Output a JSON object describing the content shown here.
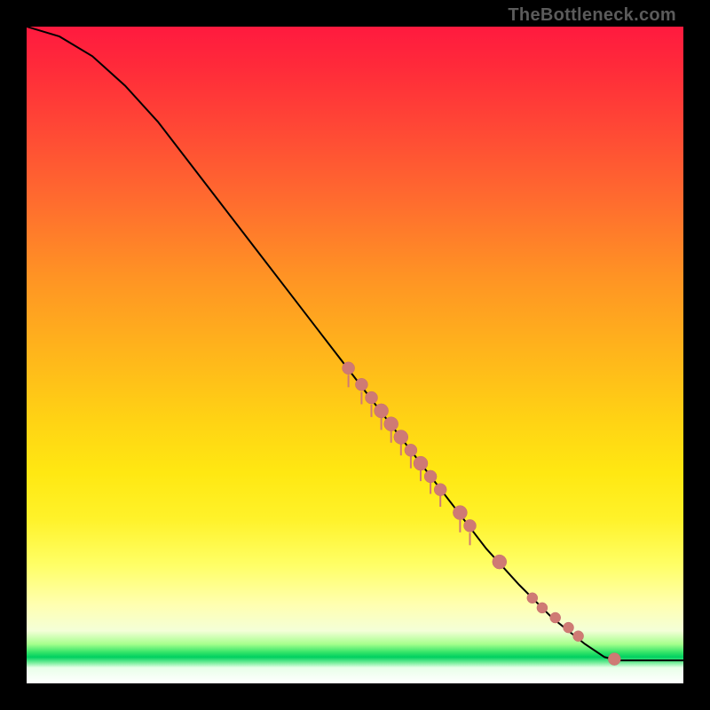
{
  "watermark": "TheBottleneck.com",
  "colors": {
    "point_fill": "#cf7a74",
    "curve_stroke": "#000000"
  },
  "chart_data": {
    "type": "line",
    "title": "",
    "xlabel": "",
    "ylabel": "",
    "xlim": [
      0,
      100
    ],
    "ylim": [
      0,
      100
    ],
    "curve": [
      {
        "x": 0,
        "y": 100
      },
      {
        "x": 5,
        "y": 98.5
      },
      {
        "x": 10,
        "y": 95.5
      },
      {
        "x": 15,
        "y": 91
      },
      {
        "x": 20,
        "y": 85.5
      },
      {
        "x": 25,
        "y": 79
      },
      {
        "x": 30,
        "y": 72.5
      },
      {
        "x": 35,
        "y": 66
      },
      {
        "x": 40,
        "y": 59.5
      },
      {
        "x": 45,
        "y": 53
      },
      {
        "x": 50,
        "y": 46.5
      },
      {
        "x": 55,
        "y": 40
      },
      {
        "x": 60,
        "y": 33.5
      },
      {
        "x": 65,
        "y": 27
      },
      {
        "x": 70,
        "y": 20.5
      },
      {
        "x": 75,
        "y": 15
      },
      {
        "x": 80,
        "y": 10
      },
      {
        "x": 85,
        "y": 6
      },
      {
        "x": 88,
        "y": 4
      },
      {
        "x": 90,
        "y": 3.5
      },
      {
        "x": 92,
        "y": 3.5
      },
      {
        "x": 96,
        "y": 3.5
      },
      {
        "x": 100,
        "y": 3.5
      }
    ],
    "points": [
      {
        "x": 49,
        "y": 48,
        "r": 7
      },
      {
        "x": 51,
        "y": 45.5,
        "r": 7
      },
      {
        "x": 52.5,
        "y": 43.5,
        "r": 7
      },
      {
        "x": 54,
        "y": 41.5,
        "r": 8
      },
      {
        "x": 55.5,
        "y": 39.5,
        "r": 8
      },
      {
        "x": 57,
        "y": 37.5,
        "r": 8
      },
      {
        "x": 58.5,
        "y": 35.5,
        "r": 7
      },
      {
        "x": 60,
        "y": 33.5,
        "r": 8
      },
      {
        "x": 61.5,
        "y": 31.5,
        "r": 7
      },
      {
        "x": 63,
        "y": 29.5,
        "r": 7
      },
      {
        "x": 66,
        "y": 26,
        "r": 8
      },
      {
        "x": 67.5,
        "y": 24,
        "r": 7
      },
      {
        "x": 72,
        "y": 18.5,
        "r": 8
      },
      {
        "x": 77,
        "y": 13,
        "r": 6
      },
      {
        "x": 78.5,
        "y": 11.5,
        "r": 6
      },
      {
        "x": 80.5,
        "y": 10,
        "r": 6
      },
      {
        "x": 82.5,
        "y": 8.5,
        "r": 6
      },
      {
        "x": 84,
        "y": 7.2,
        "r": 6
      },
      {
        "x": 89.5,
        "y": 3.7,
        "r": 7
      }
    ],
    "ticks_below_points": [
      49,
      51,
      52.5,
      54,
      55.5,
      57,
      58.5,
      60,
      61.5,
      63,
      66,
      67.5
    ]
  }
}
